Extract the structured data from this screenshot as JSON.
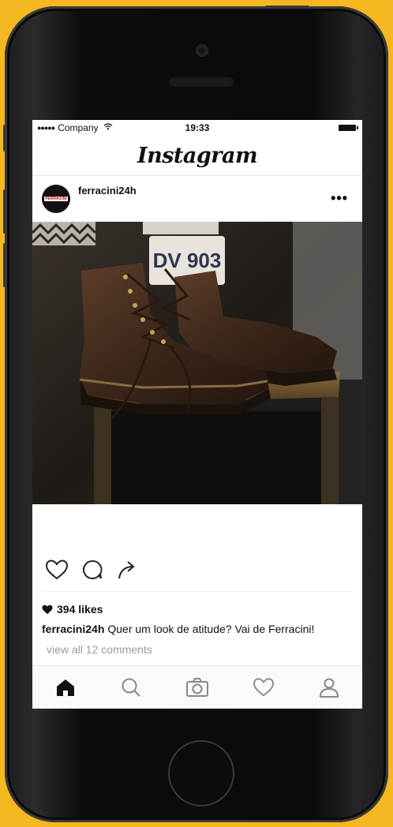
{
  "status": {
    "carrier": "Company",
    "time": "19:33"
  },
  "app": {
    "title": "Instagram"
  },
  "post": {
    "username": "ferracini24h",
    "avatar_text": "FERRACINI",
    "likes": "394 likes",
    "caption_user": "ferracini24h",
    "caption_text": "Quer um look de atitude? Vai de Ferracini!",
    "comments_link": "view all 12 comments",
    "photo_sign_text": "DV 903"
  },
  "icons": {
    "more": "more-options-icon",
    "like": "heart-icon",
    "comment": "comment-icon",
    "share": "share-icon",
    "tabs": [
      "home-icon",
      "search-icon",
      "camera-icon",
      "heart-icon",
      "profile-icon"
    ]
  },
  "colors": {
    "background": "#f6b820",
    "screen": "#ffffff",
    "muted_text": "#9a9a9a"
  }
}
